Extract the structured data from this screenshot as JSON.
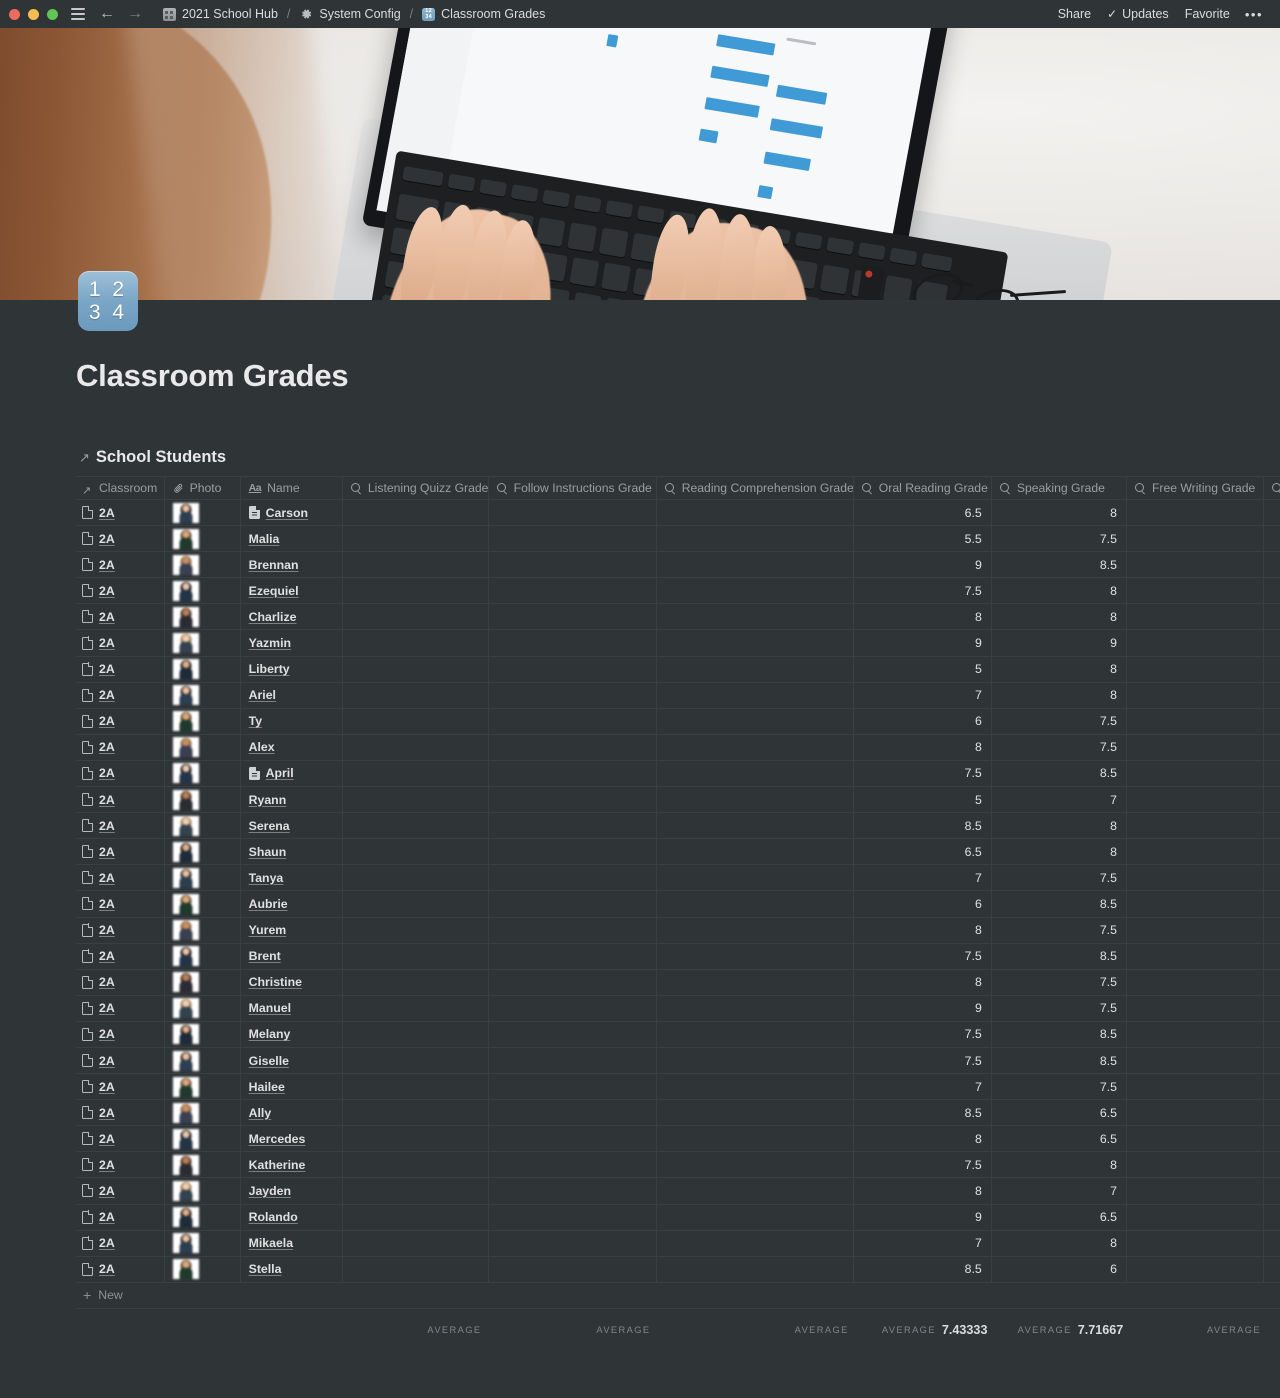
{
  "titlebar": {
    "window_controls": [
      "close",
      "minimize",
      "zoom"
    ],
    "menu_icon": "hamburger-icon",
    "back_label": "←",
    "forward_label": "→",
    "breadcrumbs": [
      {
        "icon": "building-icon",
        "label": "2021 School Hub"
      },
      {
        "icon": "gear-icon",
        "label": "System Config"
      },
      {
        "icon": "input-numbers-icon",
        "label": "Classroom Grades"
      }
    ],
    "separator": "/",
    "actions": {
      "share": "Share",
      "updates": "Updates",
      "updates_check": "✓",
      "favorite": "Favorite",
      "more": "•••"
    }
  },
  "page": {
    "icon_lines": [
      "1 2",
      "3 4"
    ],
    "icon_name": "input-numbers-icon",
    "title": "Classroom Grades"
  },
  "database": {
    "title": "School Students",
    "title_icon": "arrow-up-right-icon",
    "new_row_label": "New",
    "columns": [
      {
        "key": "classroom",
        "label": "Classroom",
        "icon": "relation-arrow-icon",
        "type": "relation"
      },
      {
        "key": "photo",
        "label": "Photo",
        "icon": "paperclip-icon",
        "type": "files"
      },
      {
        "key": "name",
        "label": "Name",
        "icon": "title-aa-icon",
        "type": "title"
      },
      {
        "key": "listening",
        "label": "Listening Quizz Grade",
        "icon": "rollup-search-icon",
        "type": "rollup"
      },
      {
        "key": "follow",
        "label": "Follow Instructions Grade",
        "icon": "rollup-search-icon",
        "type": "rollup"
      },
      {
        "key": "reading",
        "label": "Reading Comprehension Grade",
        "icon": "rollup-search-icon",
        "type": "rollup"
      },
      {
        "key": "oral",
        "label": "Oral Reading Grade",
        "icon": "rollup-search-icon",
        "type": "rollup"
      },
      {
        "key": "speaking",
        "label": "Speaking Grade",
        "icon": "rollup-search-icon",
        "type": "rollup"
      },
      {
        "key": "freewriting",
        "label": "Free Writing Grade",
        "icon": "rollup-search-icon",
        "type": "rollup"
      }
    ],
    "rows": [
      {
        "classroom": "2A",
        "name": "Carson",
        "name_has_icon": true,
        "listening": "",
        "follow": "",
        "reading": "",
        "oral": "6.5",
        "speaking": "8",
        "freewriting": ""
      },
      {
        "classroom": "2A",
        "name": "Malia",
        "name_has_icon": false,
        "listening": "",
        "follow": "",
        "reading": "",
        "oral": "5.5",
        "speaking": "7.5",
        "freewriting": ""
      },
      {
        "classroom": "2A",
        "name": "Brennan",
        "name_has_icon": false,
        "listening": "",
        "follow": "",
        "reading": "",
        "oral": "9",
        "speaking": "8.5",
        "freewriting": ""
      },
      {
        "classroom": "2A",
        "name": "Ezequiel",
        "name_has_icon": false,
        "listening": "",
        "follow": "",
        "reading": "",
        "oral": "7.5",
        "speaking": "8",
        "freewriting": ""
      },
      {
        "classroom": "2A",
        "name": "Charlize",
        "name_has_icon": false,
        "listening": "",
        "follow": "",
        "reading": "",
        "oral": "8",
        "speaking": "8",
        "freewriting": ""
      },
      {
        "classroom": "2A",
        "name": "Yazmin",
        "name_has_icon": false,
        "listening": "",
        "follow": "",
        "reading": "",
        "oral": "9",
        "speaking": "9",
        "freewriting": ""
      },
      {
        "classroom": "2A",
        "name": "Liberty",
        "name_has_icon": false,
        "listening": "",
        "follow": "",
        "reading": "",
        "oral": "5",
        "speaking": "8",
        "freewriting": ""
      },
      {
        "classroom": "2A",
        "name": "Ariel",
        "name_has_icon": false,
        "listening": "",
        "follow": "",
        "reading": "",
        "oral": "7",
        "speaking": "8",
        "freewriting": ""
      },
      {
        "classroom": "2A",
        "name": "Ty",
        "name_has_icon": false,
        "listening": "",
        "follow": "",
        "reading": "",
        "oral": "6",
        "speaking": "7.5",
        "freewriting": ""
      },
      {
        "classroom": "2A",
        "name": "Alex",
        "name_has_icon": false,
        "listening": "",
        "follow": "",
        "reading": "",
        "oral": "8",
        "speaking": "7.5",
        "freewriting": ""
      },
      {
        "classroom": "2A",
        "name": "April",
        "name_has_icon": true,
        "listening": "",
        "follow": "",
        "reading": "",
        "oral": "7.5",
        "speaking": "8.5",
        "freewriting": ""
      },
      {
        "classroom": "2A",
        "name": "Ryann",
        "name_has_icon": false,
        "listening": "",
        "follow": "",
        "reading": "",
        "oral": "5",
        "speaking": "7",
        "freewriting": ""
      },
      {
        "classroom": "2A",
        "name": "Serena",
        "name_has_icon": false,
        "listening": "",
        "follow": "",
        "reading": "",
        "oral": "8.5",
        "speaking": "8",
        "freewriting": ""
      },
      {
        "classroom": "2A",
        "name": "Shaun",
        "name_has_icon": false,
        "listening": "",
        "follow": "",
        "reading": "",
        "oral": "6.5",
        "speaking": "8",
        "freewriting": ""
      },
      {
        "classroom": "2A",
        "name": "Tanya",
        "name_has_icon": false,
        "listening": "",
        "follow": "",
        "reading": "",
        "oral": "7",
        "speaking": "7.5",
        "freewriting": ""
      },
      {
        "classroom": "2A",
        "name": "Aubrie",
        "name_has_icon": false,
        "listening": "",
        "follow": "",
        "reading": "",
        "oral": "6",
        "speaking": "8.5",
        "freewriting": ""
      },
      {
        "classroom": "2A",
        "name": "Yurem",
        "name_has_icon": false,
        "listening": "",
        "follow": "",
        "reading": "",
        "oral": "8",
        "speaking": "7.5",
        "freewriting": ""
      },
      {
        "classroom": "2A",
        "name": "Brent",
        "name_has_icon": false,
        "listening": "",
        "follow": "",
        "reading": "",
        "oral": "7.5",
        "speaking": "8.5",
        "freewriting": ""
      },
      {
        "classroom": "2A",
        "name": "Christine",
        "name_has_icon": false,
        "listening": "",
        "follow": "",
        "reading": "",
        "oral": "8",
        "speaking": "7.5",
        "freewriting": ""
      },
      {
        "classroom": "2A",
        "name": "Manuel",
        "name_has_icon": false,
        "listening": "",
        "follow": "",
        "reading": "",
        "oral": "9",
        "speaking": "7.5",
        "freewriting": ""
      },
      {
        "classroom": "2A",
        "name": "Melany",
        "name_has_icon": false,
        "listening": "",
        "follow": "",
        "reading": "",
        "oral": "7.5",
        "speaking": "8.5",
        "freewriting": ""
      },
      {
        "classroom": "2A",
        "name": "Giselle",
        "name_has_icon": false,
        "listening": "",
        "follow": "",
        "reading": "",
        "oral": "7.5",
        "speaking": "8.5",
        "freewriting": ""
      },
      {
        "classroom": "2A",
        "name": "Hailee",
        "name_has_icon": false,
        "listening": "",
        "follow": "",
        "reading": "",
        "oral": "7",
        "speaking": "7.5",
        "freewriting": ""
      },
      {
        "classroom": "2A",
        "name": "Ally",
        "name_has_icon": false,
        "listening": "",
        "follow": "",
        "reading": "",
        "oral": "8.5",
        "speaking": "6.5",
        "freewriting": ""
      },
      {
        "classroom": "2A",
        "name": "Mercedes",
        "name_has_icon": false,
        "listening": "",
        "follow": "",
        "reading": "",
        "oral": "8",
        "speaking": "6.5",
        "freewriting": ""
      },
      {
        "classroom": "2A",
        "name": "Katherine",
        "name_has_icon": false,
        "listening": "",
        "follow": "",
        "reading": "",
        "oral": "7.5",
        "speaking": "8",
        "freewriting": ""
      },
      {
        "classroom": "2A",
        "name": "Jayden",
        "name_has_icon": false,
        "listening": "",
        "follow": "",
        "reading": "",
        "oral": "8",
        "speaking": "7",
        "freewriting": ""
      },
      {
        "classroom": "2A",
        "name": "Rolando",
        "name_has_icon": false,
        "listening": "",
        "follow": "",
        "reading": "",
        "oral": "9",
        "speaking": "6.5",
        "freewriting": ""
      },
      {
        "classroom": "2A",
        "name": "Mikaela",
        "name_has_icon": false,
        "listening": "",
        "follow": "",
        "reading": "",
        "oral": "7",
        "speaking": "8",
        "freewriting": ""
      },
      {
        "classroom": "2A",
        "name": "Stella",
        "name_has_icon": false,
        "listening": "",
        "follow": "",
        "reading": "",
        "oral": "8.5",
        "speaking": "6",
        "freewriting": ""
      }
    ],
    "aggregates": [
      {
        "column": "classroom",
        "label": "",
        "value": ""
      },
      {
        "column": "photo",
        "label": "",
        "value": ""
      },
      {
        "column": "name",
        "label": "",
        "value": ""
      },
      {
        "column": "listening",
        "label": "AVERAGE",
        "value": ""
      },
      {
        "column": "follow",
        "label": "AVERAGE",
        "value": ""
      },
      {
        "column": "reading",
        "label": "AVERAGE",
        "value": ""
      },
      {
        "column": "oral",
        "label": "AVERAGE",
        "value": "7.43333"
      },
      {
        "column": "speaking",
        "label": "AVERAGE",
        "value": "7.71667"
      },
      {
        "column": "freewriting",
        "label": "AVERAGE",
        "value": ""
      }
    ]
  },
  "colors": {
    "background": "#2f3437",
    "border": "#3a3f42",
    "text_primary": "#e0e0e0",
    "text_muted": "#9b9ea0",
    "icon_blue": "#7ba6c6",
    "traffic_red": "#ed6a5e",
    "traffic_yellow": "#f4bd4f",
    "traffic_green": "#61c454"
  }
}
